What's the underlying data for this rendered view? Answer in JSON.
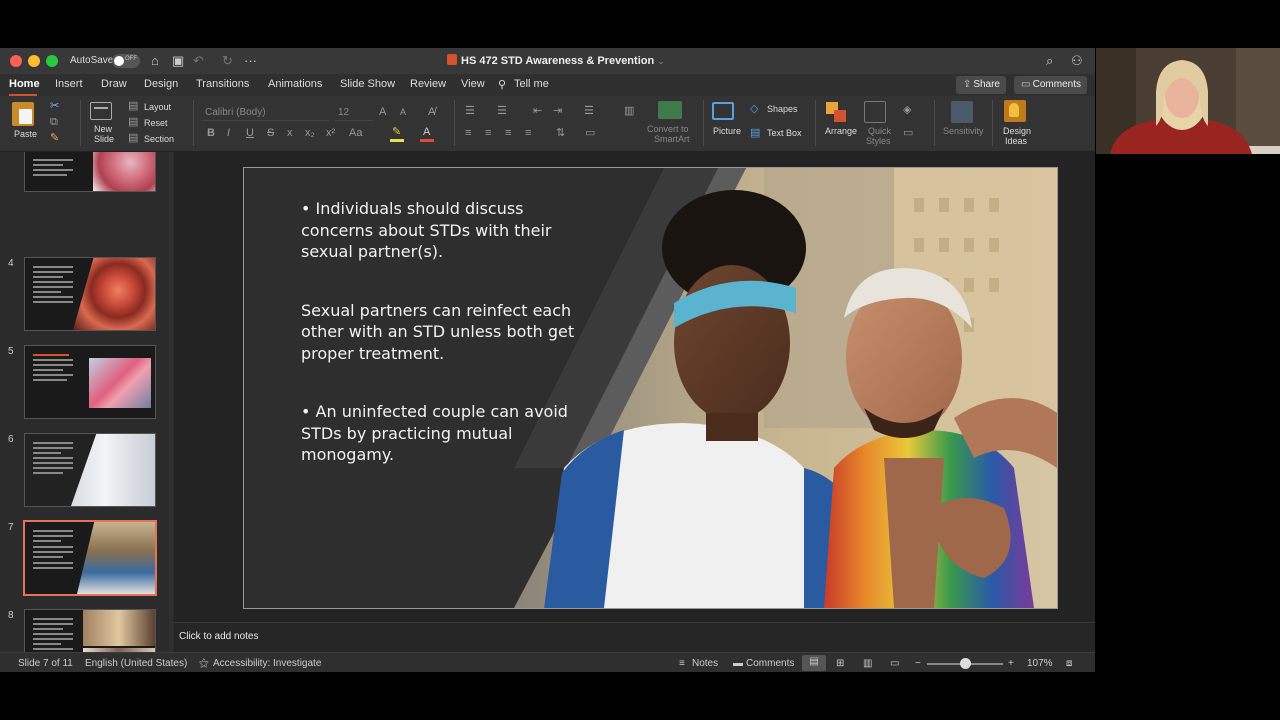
{
  "titlebar": {
    "autosave_label": "AutoSave",
    "autosave_state": "OFF",
    "doc_title": "HS 472 STD Awareness & Prevention"
  },
  "ribbon_tabs": [
    "Home",
    "Insert",
    "Draw",
    "Design",
    "Transitions",
    "Animations",
    "Slide Show",
    "Review",
    "View",
    "Tell me"
  ],
  "header_buttons": {
    "share": "Share",
    "comments": "Comments"
  },
  "ribbon": {
    "paste": "Paste",
    "new_slide": "New Slide",
    "new_slide_l1": "New",
    "new_slide_l2": "Slide",
    "layout": "Layout",
    "reset": "Reset",
    "section": "Section",
    "font_name": "Calibri (Body)",
    "font_size": "12",
    "convert_smartart_l1": "Convert to",
    "convert_smartart_l2": "SmartArt",
    "picture": "Picture",
    "shapes": "Shapes",
    "text_box": "Text Box",
    "arrange": "Arrange",
    "quick_styles_l1": "Quick",
    "quick_styles_l2": "Styles",
    "sensitivity": "Sensitivity",
    "design_ideas_l1": "Design",
    "design_ideas_l2": "Ideas"
  },
  "thumbnails": [
    {
      "num": "",
      "label": "slide-3"
    },
    {
      "num": "4",
      "label": "slide-4"
    },
    {
      "num": "5",
      "label": "slide-5"
    },
    {
      "num": "6",
      "label": "slide-6"
    },
    {
      "num": "7",
      "label": "slide-7"
    },
    {
      "num": "8",
      "label": "slide-8"
    }
  ],
  "slide": {
    "bullet_1": "• Individuals should discuss concerns about STDs with their sexual partner(s).",
    "bullet_2": " Sexual partners can reinfect each other with an STD unless both get proper treatment.",
    "bullet_3": "• An uninfected couple can avoid STDs by practicing mutual monogamy."
  },
  "notes_placeholder": "Click to add notes",
  "statusbar": {
    "slide_pos": "Slide 7 of 11",
    "language": "English (United States)",
    "accessibility": "Accessibility: Investigate",
    "notes": "Notes",
    "comments": "Comments",
    "zoom": "107%"
  },
  "colors": {
    "accent": "#d35230",
    "selected_thumb": "#e5735c",
    "window_bg": "#2b2b2b"
  }
}
